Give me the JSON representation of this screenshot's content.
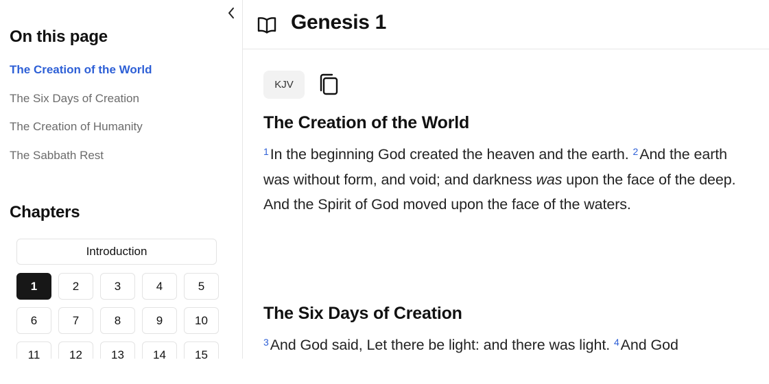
{
  "sidebar": {
    "on_this_page_title": "On this page",
    "toc": [
      {
        "label": "The Creation of the World",
        "active": true
      },
      {
        "label": "The Six Days of Creation",
        "active": false
      },
      {
        "label": "The Creation of Humanity",
        "active": false
      },
      {
        "label": "The Sabbath Rest",
        "active": false
      }
    ],
    "chapters_title": "Chapters",
    "intro_label": "Introduction",
    "chapters": [
      "1",
      "2",
      "3",
      "4",
      "5",
      "6",
      "7",
      "8",
      "9",
      "10",
      "11",
      "12",
      "13",
      "14",
      "15"
    ],
    "active_chapter": "1"
  },
  "header": {
    "title": "Genesis 1"
  },
  "main": {
    "version_label": "KJV",
    "sections": [
      {
        "heading": "The Creation of the World",
        "verses": [
          {
            "num": "1",
            "text": "In the beginning God created the heaven and the earth. "
          },
          {
            "num": "2",
            "text_before": "And the earth was without form, and void; and darkness ",
            "italic": "was",
            "text_after": " upon the face of the deep. And the Spirit of God moved upon the face of the waters."
          }
        ]
      },
      {
        "heading": "The Six Days of Creation",
        "verses": [
          {
            "num": "3",
            "text": "And God said, Let there be light: and there was light. "
          },
          {
            "num": "4",
            "text": "And God"
          }
        ]
      }
    ]
  },
  "colors": {
    "accent": "#2d5fd6",
    "active_chip": "#171717"
  }
}
